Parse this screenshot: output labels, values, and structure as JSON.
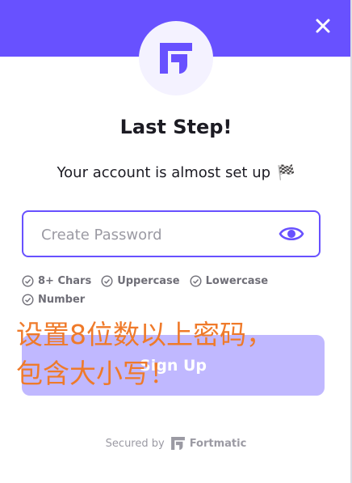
{
  "header": {
    "accent_color": "#6851ff",
    "close_icon": "close-icon",
    "logo_icon": "fortmatic-logo"
  },
  "content": {
    "title": "Last Step!",
    "subtitle": "Your account is almost set up",
    "subtitle_emoji": "🏁"
  },
  "password": {
    "placeholder": "Create Password",
    "value": "",
    "toggle_icon": "eye-icon"
  },
  "requirements": [
    {
      "label": "8+ Chars",
      "icon": "check-circle-icon"
    },
    {
      "label": "Uppercase",
      "icon": "check-circle-icon"
    },
    {
      "label": "Lowercase",
      "icon": "check-circle-icon"
    },
    {
      "label": "Number",
      "icon": "check-circle-icon"
    }
  ],
  "signup_button": {
    "label": "Sign Up",
    "color": "#c0b8ff"
  },
  "annotation": {
    "text_line1": "设置8位数以上密码，",
    "text_line2": "包含大小写！",
    "color": "#ef7a2a"
  },
  "footer": {
    "secured_by": "Secured by",
    "brand": "Fortmatic"
  }
}
